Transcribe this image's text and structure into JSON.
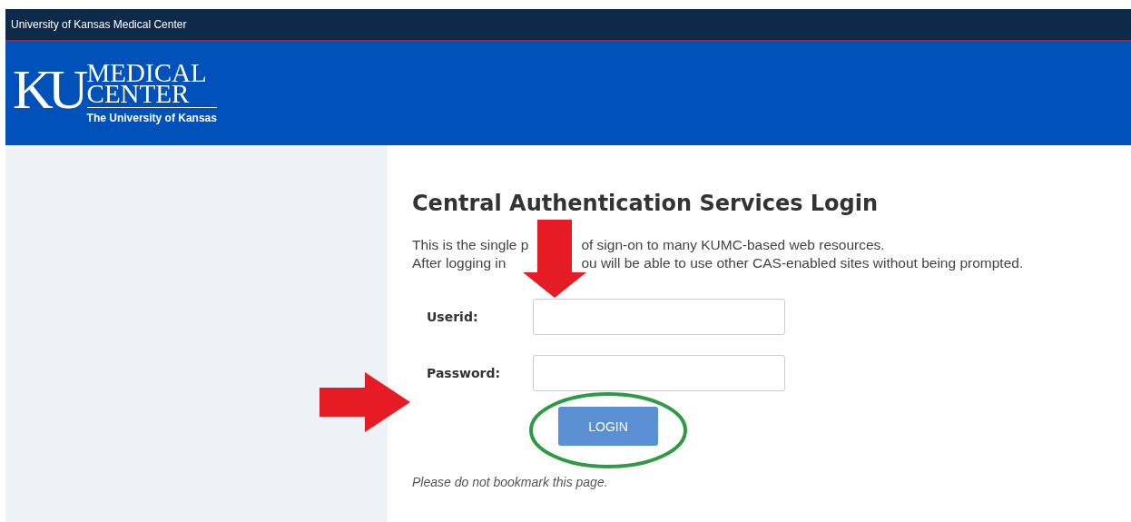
{
  "topbar": {
    "title": "University of Kansas Medical Center"
  },
  "logo": {
    "monogram": "KU",
    "line_1": "MEDICAL",
    "line_2": "CENTER",
    "subtitle": "The University of Kansas"
  },
  "login": {
    "title": "Central Authentication Services Login",
    "intro_lines": [
      [
        "This is the single p",
        "of sign-on to many KUMC-based web resources."
      ],
      [
        "After logging in",
        "ou will be able to use other CAS-enabled sites without being prompted."
      ]
    ],
    "fields": [
      {
        "label": "Userid:"
      },
      {
        "label": "Password:"
      }
    ],
    "button": "LOGIN",
    "note": "Please do not bookmark this page."
  }
}
